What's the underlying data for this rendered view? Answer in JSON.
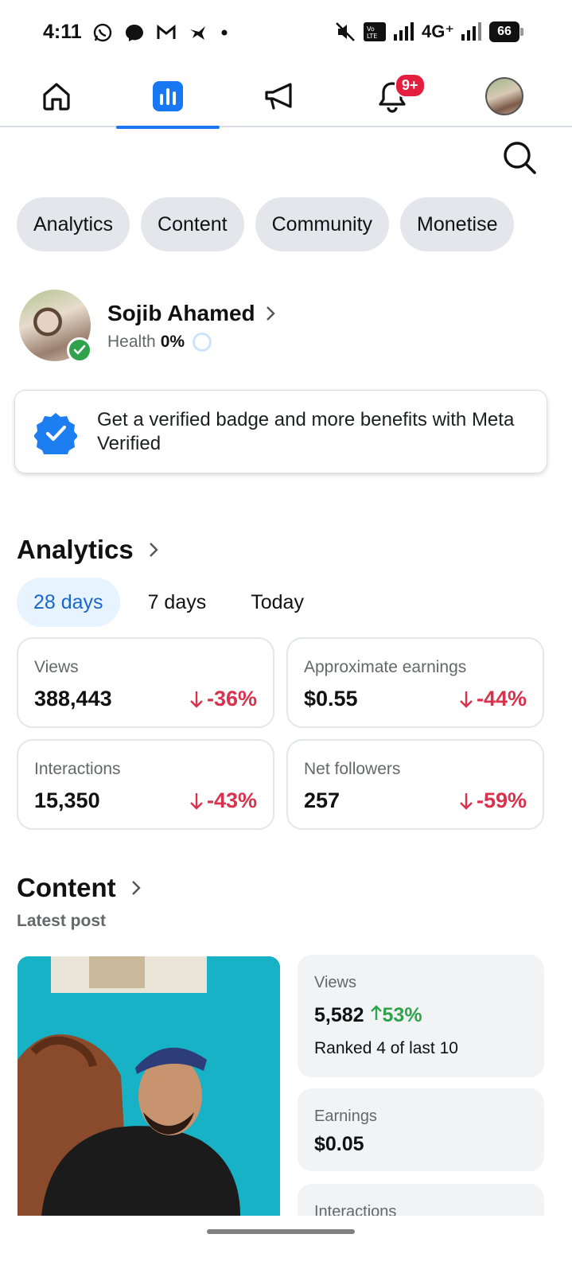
{
  "status_bar": {
    "time": "4:11",
    "network": "4G⁺",
    "battery": "66"
  },
  "notifications": {
    "badge": "9+"
  },
  "chips": [
    "Analytics",
    "Content",
    "Community",
    "Monetise"
  ],
  "profile": {
    "name": "Sojib Ahamed",
    "health_label": "Health",
    "health_value": "0%"
  },
  "verified_card": {
    "text": "Get a verified badge and more benefits with Meta Verified"
  },
  "analytics": {
    "title": "Analytics",
    "ranges": [
      "28 days",
      "7 days",
      "Today"
    ],
    "active_range": "28 days",
    "stats": [
      {
        "label": "Views",
        "value": "388,443",
        "change": "-36%"
      },
      {
        "label": "Approximate earnings",
        "value": "$0.55",
        "change": "-44%"
      },
      {
        "label": "Interactions",
        "value": "15,350",
        "change": "-43%"
      },
      {
        "label": "Net followers",
        "value": "257",
        "change": "-59%"
      }
    ]
  },
  "content": {
    "title": "Content",
    "subtitle": "Latest post",
    "views_label": "Views",
    "views_value": "5,582",
    "views_change": "53%",
    "rank": "Ranked 4 of last 10",
    "earnings_label": "Earnings",
    "earnings_value": "$0.05",
    "interactions_label": "Interactions"
  },
  "colors": {
    "accent": "#1877f2",
    "negative": "#d8324d",
    "positive": "#31a24c",
    "chip_bg": "#e4e6eb"
  }
}
